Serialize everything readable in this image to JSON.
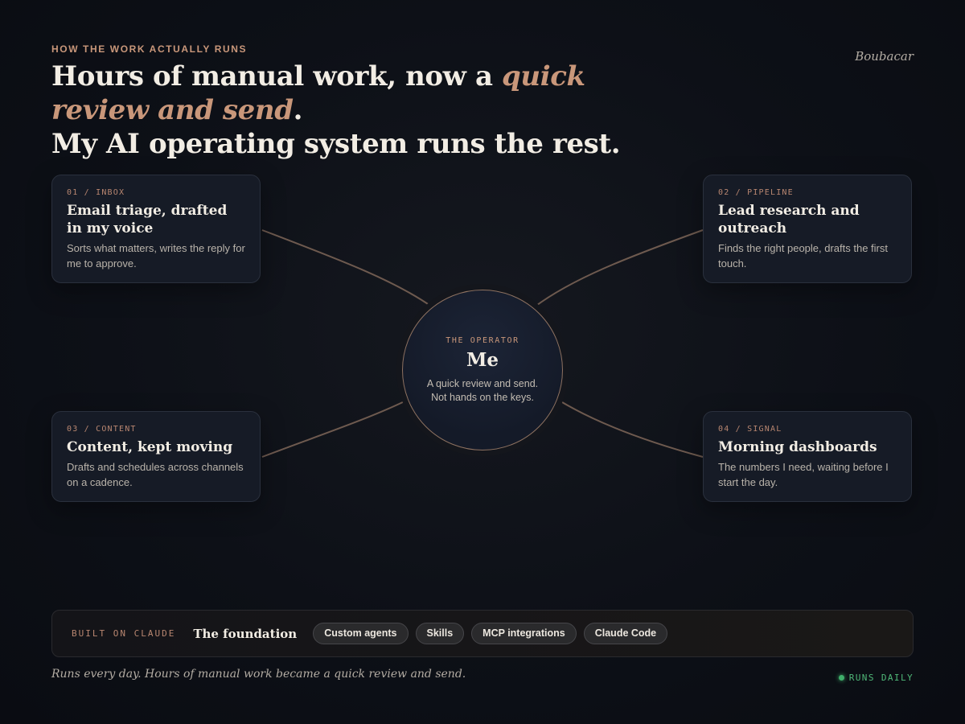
{
  "eyebrow": "HOW THE WORK ACTUALLY RUNS",
  "signature": "Boubacar",
  "headline": {
    "part1": "Hours of manual work, now a ",
    "accent": "quick review and send",
    "part2": ".",
    "line2": "My AI operating system runs the rest."
  },
  "hub": {
    "tag": "THE OPERATOR",
    "name": "Me",
    "line1": "A quick review and send.",
    "line2": "Not hands on the keys."
  },
  "cards": [
    {
      "tag": "01 / INBOX",
      "title": "Email triage, drafted in my voice",
      "desc": "Sorts what matters, writes the reply for me to approve."
    },
    {
      "tag": "02 / PIPELINE",
      "title": "Lead research and outreach",
      "desc": "Finds the right people, drafts the first touch."
    },
    {
      "tag": "03 / CONTENT",
      "title": "Content, kept moving",
      "desc": "Drafts and schedules across channels on a cadence."
    },
    {
      "tag": "04 / SIGNAL",
      "title": "Morning dashboards",
      "desc": "The numbers I need, waiting before I start the day."
    }
  ],
  "foundation": {
    "label": "BUILT ON CLAUDE",
    "heading": "The foundation",
    "chips": [
      "Custom agents",
      "Skills",
      "MCP integrations",
      "Claude Code"
    ]
  },
  "footer_note": "Runs every day. Hours of manual work became a quick review and send.",
  "status": "RUNS DAILY",
  "colors": {
    "accent": "#c9977a",
    "background": "#0d1017",
    "card": "#161b26",
    "status_green": "#3fae6a"
  }
}
